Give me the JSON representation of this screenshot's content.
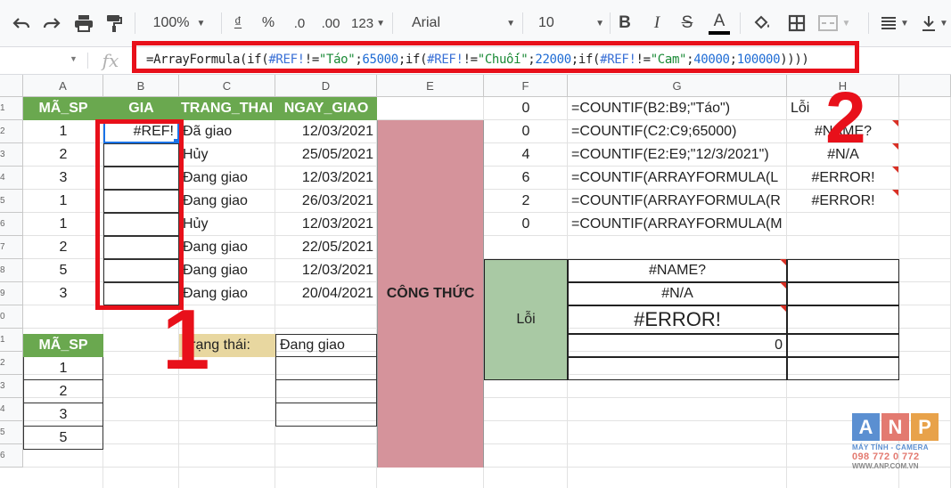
{
  "toolbar": {
    "zoom": "100%",
    "currency": "₫",
    "percent": "%",
    "dec_less": ".0",
    "dec_more": ".00",
    "more_formats": "123",
    "font": "Arial",
    "font_size": "10",
    "bold": "B",
    "italic": "I",
    "strike": "S",
    "text_color": "A"
  },
  "formula_bar": {
    "fx": "fx",
    "parts": [
      "=ArrayFormula(if(",
      "#REF!",
      "!=",
      "\"Táo\"",
      ";",
      "65000",
      ";if(",
      "#REF!",
      "!=",
      "\"Chuối\"",
      ";",
      "22000",
      ";if(",
      "#REF!",
      "!=",
      "\"Cam\"",
      ";",
      "40000",
      ";",
      "100000",
      "))))"
    ]
  },
  "columns": [
    "A",
    "B",
    "C",
    "D",
    "E",
    "F",
    "G",
    "H"
  ],
  "rows": [
    "1",
    "2",
    "3",
    "4",
    "5",
    "6",
    "7",
    "8",
    "9",
    "0",
    "1",
    "2",
    "3",
    "4",
    "5",
    "6"
  ],
  "sheet": {
    "headers": {
      "ma_sp": "MÃ_SP",
      "gia": "GIA",
      "trang_thai": "TRANG_THAI",
      "ngay_giao": "NGAY_GIAO"
    },
    "ma_sp": [
      "1",
      "2",
      "3",
      "1",
      "1",
      "2",
      "5",
      "3"
    ],
    "gia_first": "#REF!",
    "trang_thai": [
      "Đã giao",
      "Hủy",
      "Đang giao",
      "Đang giao",
      "Hủy",
      "Đang giao",
      "Đang giao",
      "Đang giao"
    ],
    "ngay_giao": [
      "12/03/2021",
      "25/05/2021",
      "12/03/2021",
      "26/03/2021",
      "12/03/2021",
      "22/05/2021",
      "12/03/2021",
      "20/04/2021"
    ],
    "cong_thuc": "CÔNG THỨC",
    "f_vals": [
      "0",
      "0",
      "4",
      "6",
      "2",
      "0"
    ],
    "g_formulas": [
      "=COUNTIF(B2:B9;\"Táo\")",
      "=COUNTIF(C2:C9;65000)",
      "=COUNTIF(E2:E9;\"12/3/2021\")",
      "=COUNTIF(ARRAYFORMULA(L",
      "=COUNTIF(ARRAYFORMULA(R",
      "=COUNTIF(ARRAYFORMULA(M"
    ],
    "h_vals": [
      "Lỗi",
      "#NAME?",
      "#N/A",
      "#ERROR!",
      "#ERROR!"
    ],
    "loi": "Lỗi",
    "errors": [
      "#NAME?",
      "#N/A",
      "#ERROR!"
    ],
    "zero": "0",
    "ma_sp2_header": "MÃ_SP",
    "ma_sp2": [
      "1",
      "2",
      "3",
      "5"
    ],
    "status_label": "Trạng thái:",
    "status_value": "Đang giao"
  },
  "annotations": {
    "one": "1",
    "two": "2"
  },
  "logo": {
    "letters": [
      "A",
      "N",
      "P"
    ],
    "tagline": "MÁY TÍNH - CAMERA",
    "phone": "098 772 0 772",
    "site": "WWW.ANP.COM.VN"
  },
  "colors": {
    "header_green": "#6aa84f",
    "formula_pink": "#d5939b",
    "loi_green": "#a9c9a4",
    "status_tan": "#e8d7a0",
    "annotation_red": "#e8101a"
  }
}
